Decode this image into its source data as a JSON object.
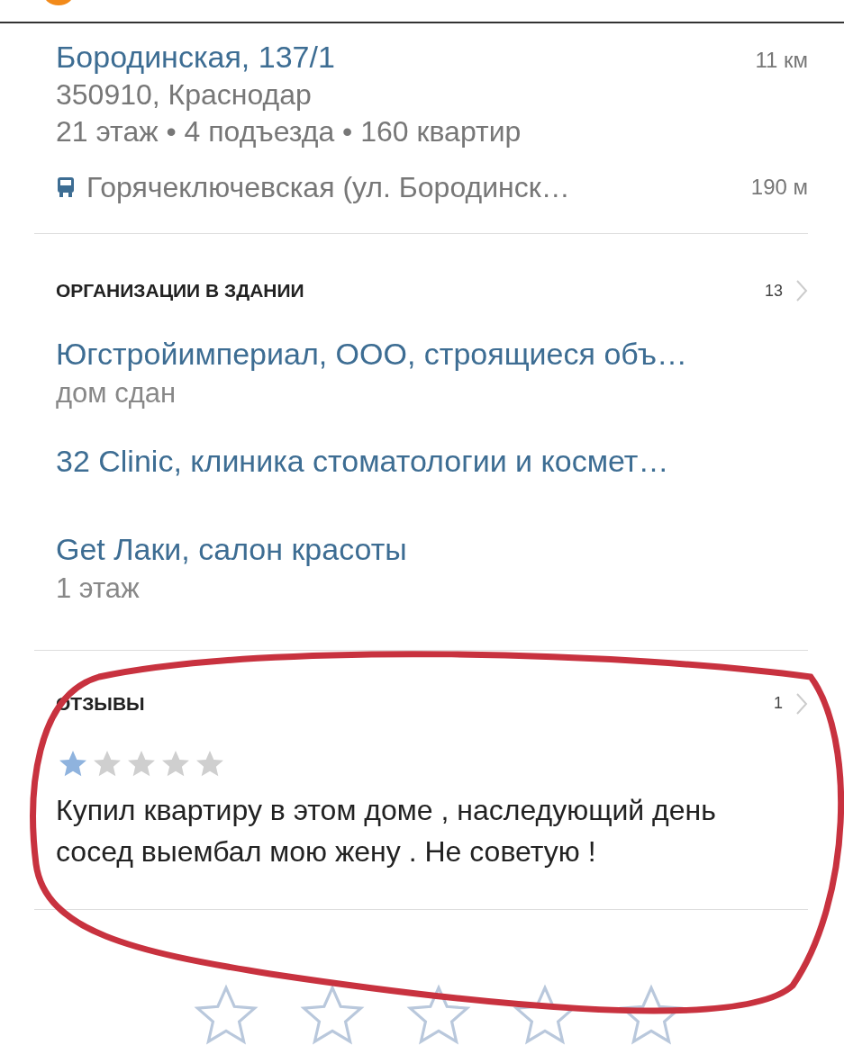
{
  "address": {
    "title": "Бородинская, 137/1",
    "distance": "11 км",
    "postal": "350910, Краснодар",
    "details": "21 этаж • 4 подъезда • 160 квартир",
    "stop": {
      "name": "Горячеключевская (ул. Бородинск…",
      "distance": "190 м"
    }
  },
  "organizations": {
    "header": "ОРГАНИЗАЦИИ В ЗДАНИИ",
    "count": "13",
    "items": [
      {
        "name": "Югстройимпериал, ООО, строящиеся объ…",
        "note": "дом сдан"
      },
      {
        "name": "32 Clinic, клиника стоматологии и космет…"
      },
      {
        "name": "Get Лаки, салон красоты",
        "note": "1 этаж"
      }
    ]
  },
  "reviews": {
    "header": "ОТЗЫВЫ",
    "count": "1",
    "items": [
      {
        "stars": 1,
        "text": "Купил квартиру в этом доме , наследующий день сосед выембал мою жену . Не советую !"
      }
    ]
  }
}
